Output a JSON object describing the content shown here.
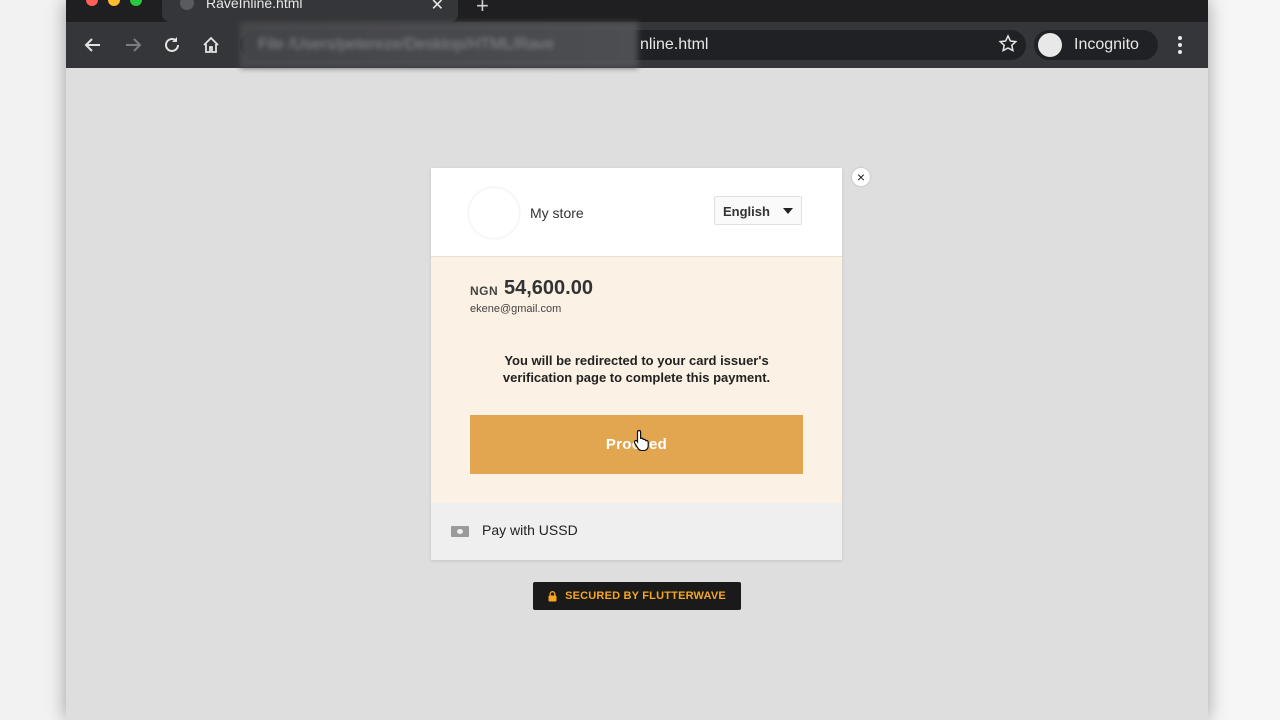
{
  "browser": {
    "tab_title": "RaveInline.html",
    "url_blurred_part": "File   /Users/petereze/Desktop/HTML/Rave",
    "url_visible_part": "nline.html",
    "profile_label": "Incognito"
  },
  "modal": {
    "store_name": "My store",
    "language": "English",
    "currency": "NGN",
    "amount": "54,600.00",
    "email": "ekene@gmail.com",
    "redirect_message": "You will be redirected to your card issuer's verification page to complete this payment.",
    "proceed_label": "Proceed",
    "alt_payment_label": "Pay with USSD",
    "close_symbol": "×"
  },
  "footer": {
    "secured_label": "SECURED BY FLUTTERWAVE"
  },
  "colors": {
    "accent": "#e3a650",
    "body_bg": "#fbf1e5",
    "badge_text": "#f5a623"
  }
}
